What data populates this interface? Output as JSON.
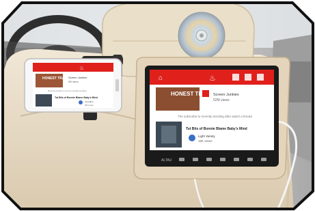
{
  "headrest_screen": {
    "tab_fire_icon": "flame-icon",
    "tab_home_icon": "home-icon",
    "video_top": {
      "thumbnail_title": "HONEST TRAILERS",
      "channel_name": "Screen Junkies",
      "meta": "52M views"
    },
    "suggest_line": "The subscribe to recently trending after watch a thread",
    "video_bottom": {
      "title": "Tut Bits of Bonnie Blame Baby's Mind",
      "channel_name": "Light Variety",
      "meta": "18K views"
    },
    "bottom_bar_label": "ALTAU"
  },
  "phone_screen": {
    "tab_fire_icon": "flame-icon",
    "thumb_title": "HONEST TRAILERS",
    "channel_name": "Screen Junkies",
    "meta": "5M views",
    "suggest_line": "Recommended to you by recently trending",
    "video_title": "Tut Bits of Bonnie Blame Baby's Mind",
    "video_channel": "Lucy Boo",
    "video_meta": "4M views"
  },
  "colors": {
    "app_red": "#e0201b",
    "seat_beige": "#e9dcc6",
    "screen_frame": "#1a1a1a",
    "cd_silver": "#cfcfcf"
  }
}
